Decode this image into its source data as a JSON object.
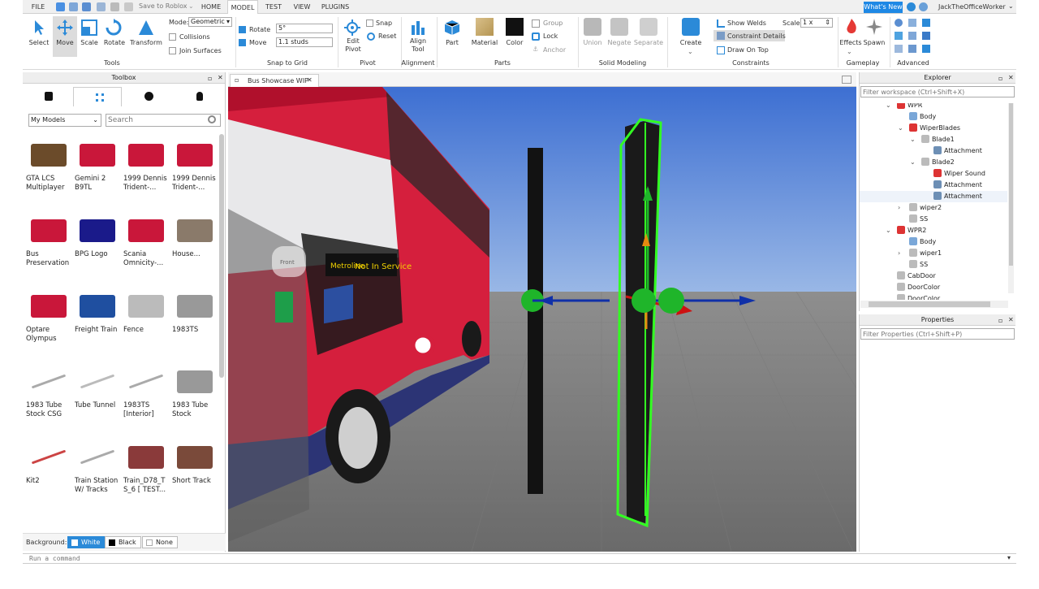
{
  "menubar": {
    "file": "FILE",
    "save_label": "Save to Roblox",
    "tabs": [
      "HOME",
      "MODEL",
      "TEST",
      "VIEW",
      "PLUGINS"
    ],
    "active_tab": "MODEL",
    "whats_new": "What's New",
    "username": "JackTheOfficeWorker"
  },
  "ribbon": {
    "tools": {
      "select": "Select",
      "move": "Move",
      "scale": "Scale",
      "rotate": "Rotate",
      "transform": "Transform",
      "group": "Tools"
    },
    "mode": {
      "label": "Mode:",
      "value": "Geometric",
      "collisions": "Collisions",
      "join_surfaces": "Join Surfaces"
    },
    "snap": {
      "rotate": "Rotate",
      "rotate_value": "5°",
      "move": "Move",
      "move_value": "1.1 studs",
      "group": "Snap to Grid"
    },
    "pivot": {
      "edit": "Edit\nPivot",
      "snap": "Snap",
      "reset": "Reset",
      "group": "Pivot"
    },
    "alignment": {
      "align": "Align\nTool",
      "group": "Alignment"
    },
    "parts": {
      "part": "Part",
      "material": "Material",
      "color": "Color",
      "group_btn": "Group",
      "lock": "Lock",
      "anchor": "Anchor",
      "group": "Parts"
    },
    "solid": {
      "union": "Union",
      "negate": "Negate",
      "separate": "Separate",
      "group": "Solid Modeling"
    },
    "constraints": {
      "create": "Create",
      "show_welds": "Show Welds",
      "scale_label": "Scale",
      "scale_value": "1 x",
      "constraint_details": "Constraint Details",
      "draw_on_top": "Draw On Top",
      "group": "Constraints"
    },
    "gameplay": {
      "effects": "Effects",
      "spawn": "Spawn",
      "group": "Gameplay"
    },
    "advanced": {
      "group": "Advanced"
    }
  },
  "toolbox": {
    "title": "Toolbox",
    "category": "My Models",
    "search_placeholder": "Search",
    "items": [
      {
        "name": "GTA LCS\nMultiplayer"
      },
      {
        "name": "Gemini 2\nB9TL"
      },
      {
        "name": "1999 Dennis\nTrident-..."
      },
      {
        "name": "1999 Dennis\nTrident-..."
      },
      {
        "name": "Bus\nPreservation"
      },
      {
        "name": "BPG Logo"
      },
      {
        "name": "Scania\nOmnicity-..."
      },
      {
        "name": "House..."
      },
      {
        "name": "Optare\nOlympus"
      },
      {
        "name": "Freight Train"
      },
      {
        "name": "Fence"
      },
      {
        "name": "1983TS"
      },
      {
        "name": "1983 Tube\nStock CSG"
      },
      {
        "name": "Tube Tunnel"
      },
      {
        "name": "1983TS\n[Interior]"
      },
      {
        "name": "1983 Tube\nStock"
      },
      {
        "name": "Kit2"
      },
      {
        "name": "Train Station\nW/ Tracks"
      },
      {
        "name": "Train_D78_T\nS_6 [ TEST..."
      },
      {
        "name": "Short Track"
      }
    ],
    "background": {
      "label": "Background:",
      "white": "White",
      "black": "Black",
      "none": "None"
    }
  },
  "viewport": {
    "tab_label": "Bus Showcase WIP",
    "front_label": "Front",
    "bus_sign": "Metroline",
    "bus_dest": "Not In Service"
  },
  "explorer": {
    "title": "Explorer",
    "filter_placeholder": "Filter workspace (Ctrl+Shift+X)",
    "rows": [
      {
        "label": "WPR",
        "depth": 0,
        "kind": "model",
        "arrow": "open"
      },
      {
        "label": "Body",
        "depth": 1,
        "kind": "part",
        "arrow": ""
      },
      {
        "label": "WiperBlades",
        "depth": 1,
        "kind": "model",
        "arrow": "open"
      },
      {
        "label": "Blade1",
        "depth": 2,
        "kind": "union",
        "arrow": "open"
      },
      {
        "label": "Attachment",
        "depth": 3,
        "kind": "attach",
        "arrow": ""
      },
      {
        "label": "Blade2",
        "depth": 2,
        "kind": "union",
        "arrow": "open"
      },
      {
        "label": "Wiper Sound",
        "depth": 3,
        "kind": "sound",
        "arrow": ""
      },
      {
        "label": "Attachment",
        "depth": 3,
        "kind": "attach",
        "arrow": ""
      },
      {
        "label": "Attachment",
        "depth": 3,
        "kind": "attach",
        "arrow": "",
        "hover": true
      },
      {
        "label": "wiper2",
        "depth": 1,
        "kind": "union",
        "arrow": "closed"
      },
      {
        "label": "SS",
        "depth": 1,
        "kind": "union",
        "arrow": ""
      },
      {
        "label": "WPR2",
        "depth": 0,
        "kind": "model",
        "arrow": "open"
      },
      {
        "label": "Body",
        "depth": 1,
        "kind": "part",
        "arrow": ""
      },
      {
        "label": "wiper1",
        "depth": 1,
        "kind": "union",
        "arrow": "closed"
      },
      {
        "label": "SS",
        "depth": 1,
        "kind": "union",
        "arrow": ""
      },
      {
        "label": "CabDoor",
        "depth": 0,
        "kind": "union",
        "arrow": ""
      },
      {
        "label": "DoorColor",
        "depth": 0,
        "kind": "union",
        "arrow": ""
      },
      {
        "label": "DoorColor",
        "depth": 0,
        "kind": "union",
        "arrow": ""
      }
    ]
  },
  "properties": {
    "title": "Properties",
    "filter_placeholder": "Filter Properties (Ctrl+Shift+P)"
  },
  "command": {
    "placeholder": "Run a command"
  },
  "colors": {
    "accent": "#2b8ad8",
    "selection": "#33ff22",
    "sky": "#5a8fd8",
    "bus_red": "#d51f3d"
  }
}
